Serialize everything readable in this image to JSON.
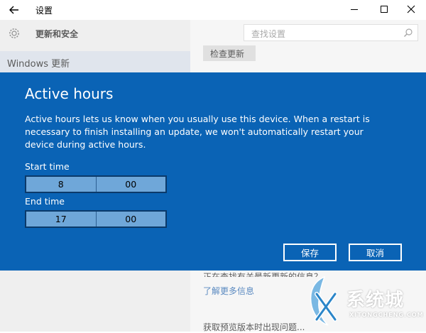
{
  "window": {
    "title": "设置",
    "back_icon": "back-arrow-icon",
    "min_icon": "minimize-icon",
    "max_icon": "maximize-icon",
    "close_icon": "close-icon"
  },
  "background": {
    "header_title": "更新和安全",
    "header_icon": "gear-icon",
    "search_placeholder": "查找设置",
    "search_icon": "search-icon",
    "nav_selected_label": "Windows 更新",
    "check_button_label": "检查更新",
    "partial_text": "正在查找有关最新更新的信息？",
    "learn_more_link": "了解更多信息",
    "preview_text": "获取预览版本时出现问题..."
  },
  "dialog": {
    "title": "Active hours",
    "description": "Active hours lets us know when you usually use this device. When a restart is necessary to finish installing an update, we won't automatically restart your device during active hours.",
    "start_label": "Start time",
    "start_hour": "8",
    "start_minute": "00",
    "end_label": "End time",
    "end_hour": "17",
    "end_minute": "00",
    "save_label": "保存",
    "cancel_label": "取消",
    "accent_color": "#0a63b5"
  },
  "watermark": {
    "cn": "系统城",
    "en": "XITONGCHENG.COM"
  }
}
